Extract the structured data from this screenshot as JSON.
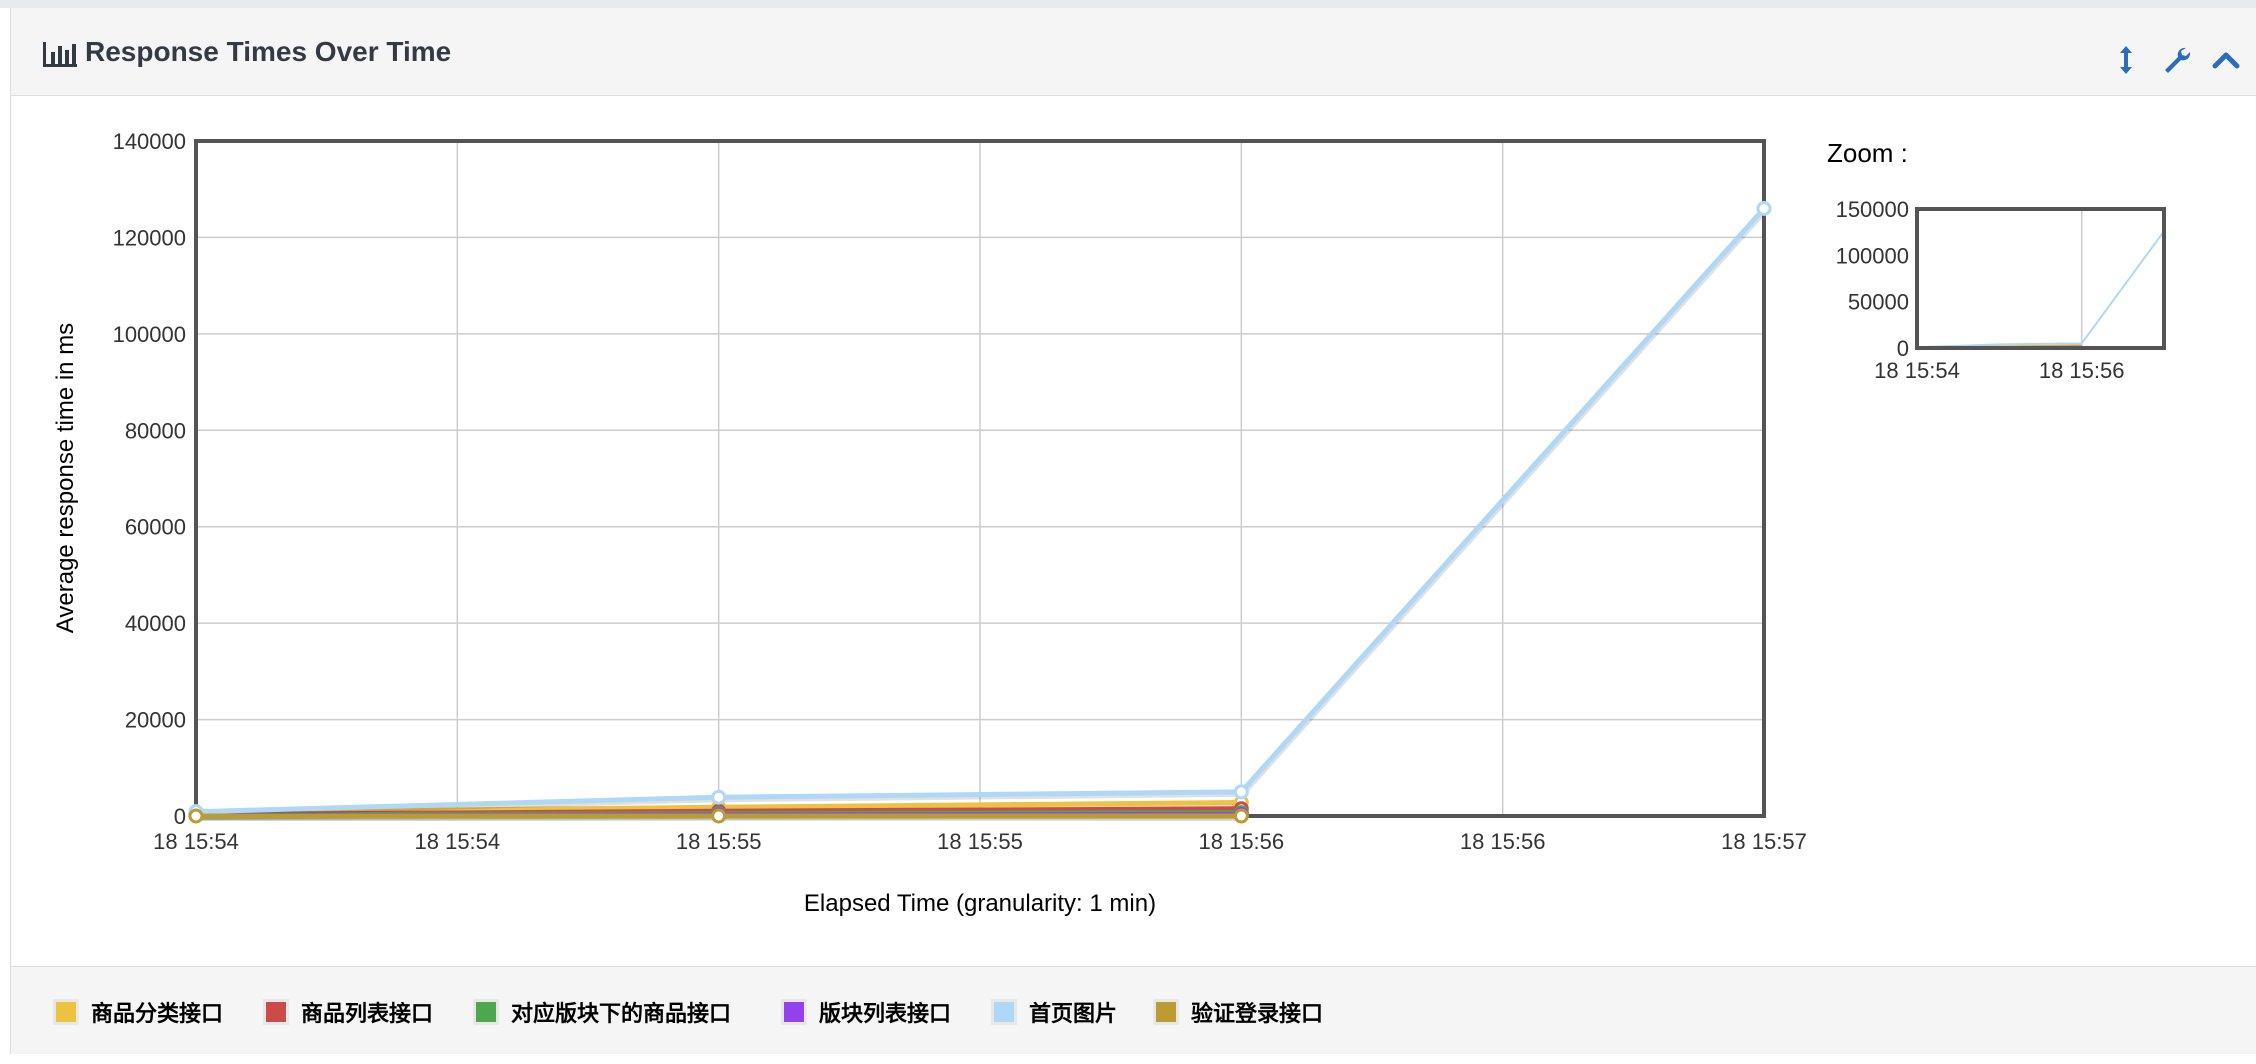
{
  "panel": {
    "title": "Response Times Over Time",
    "tools": [
      "resize-icon",
      "wrench-icon",
      "collapse-icon"
    ]
  },
  "zoom": {
    "label": "Zoom :",
    "yticks": [
      "150000",
      "100000",
      "50000",
      "0"
    ],
    "xticks": [
      "18 15:54",
      "18 15:56"
    ]
  },
  "colors": {
    "accent": "#2a6ebb",
    "axis": "#545454",
    "grid": "#cccccc"
  },
  "chart_data": {
    "type": "line",
    "title": "",
    "xlabel": "Elapsed Time (granularity: 1 min)",
    "ylabel": "Average response time in ms",
    "ylim": [
      0,
      140000
    ],
    "yticks": [
      0,
      20000,
      40000,
      60000,
      80000,
      100000,
      120000,
      140000
    ],
    "x_tick_labels": [
      "18 15:54",
      "18 15:54",
      "18 15:55",
      "18 15:55",
      "18 15:56",
      "18 15:56",
      "18 15:57"
    ],
    "x_points": [
      "18 15:54",
      "18 15:55",
      "18 15:56",
      "18 15:57"
    ],
    "grid": true,
    "legend_position": "bottom",
    "series": [
      {
        "name": "商品分类接口",
        "color": "#edc240",
        "values": [
          700,
          1800,
          2800,
          null
        ]
      },
      {
        "name": "商品列表接口",
        "color": "#cb4b4b",
        "values": [
          300,
          1000,
          1500,
          null
        ]
      },
      {
        "name": "对应版块下的商品接口",
        "color": "#4da74d",
        "values": [
          200,
          500,
          700,
          null
        ]
      },
      {
        "name": "版块列表接口",
        "color": "#9440ed",
        "values": [
          100,
          200,
          300,
          null
        ]
      },
      {
        "name": "首页图片",
        "color": "#afd8f8",
        "values": [
          900,
          3900,
          5000,
          126000
        ]
      },
      {
        "name": "验证登录接口",
        "color": "#bd9b33",
        "values": [
          0,
          0,
          0,
          null
        ]
      }
    ]
  }
}
